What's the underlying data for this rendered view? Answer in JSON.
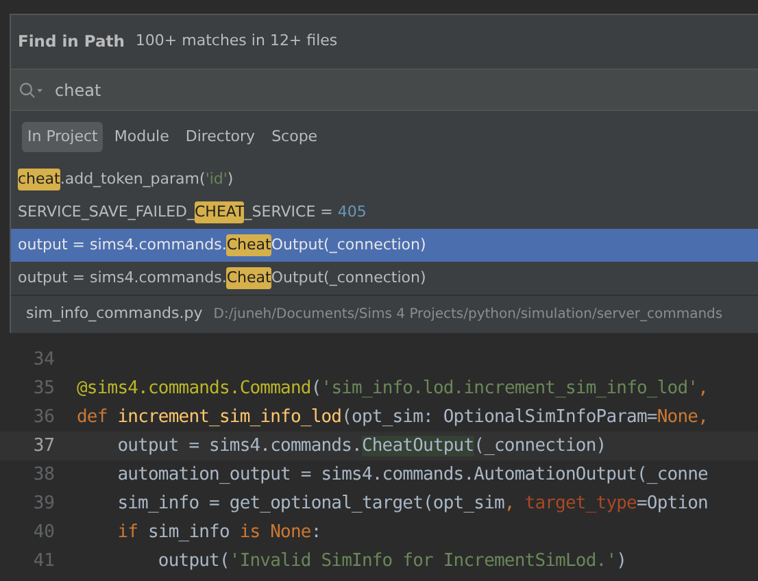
{
  "dialog": {
    "title": "Find in Path",
    "summary": "100+ matches in 12+ files",
    "search": {
      "value": "cheat"
    },
    "scopes": [
      {
        "label": "In Project",
        "selected": true
      },
      {
        "label": "Module",
        "selected": false
      },
      {
        "label": "Directory",
        "selected": false
      },
      {
        "label": "Scope",
        "selected": false
      }
    ],
    "results": [
      {
        "selected": false,
        "segments": [
          {
            "text": "cheat",
            "kind": "match"
          },
          {
            "text": ".add_token_param(",
            "kind": "plain"
          },
          {
            "text": "'id'",
            "kind": "string"
          },
          {
            "text": ")",
            "kind": "plain"
          }
        ]
      },
      {
        "selected": false,
        "segments": [
          {
            "text": "SERVICE_SAVE_FAILED_",
            "kind": "plain"
          },
          {
            "text": "CHEAT",
            "kind": "match"
          },
          {
            "text": "_SERVICE = ",
            "kind": "plain"
          },
          {
            "text": "405",
            "kind": "number"
          }
        ]
      },
      {
        "selected": true,
        "segments": [
          {
            "text": "output = sims4.commands.",
            "kind": "plain"
          },
          {
            "text": "Cheat",
            "kind": "match"
          },
          {
            "text": "Output(_connection)",
            "kind": "plain"
          }
        ]
      },
      {
        "selected": false,
        "segments": [
          {
            "text": "output = sims4.commands.",
            "kind": "plain"
          },
          {
            "text": "Cheat",
            "kind": "match"
          },
          {
            "text": "Output(_connection)",
            "kind": "plain"
          }
        ]
      }
    ],
    "preview": {
      "file": "sim_info_commands.py",
      "path": "D:/juneh/Documents/Sims 4 Projects/python/simulation/server_commands"
    }
  },
  "editor": {
    "lines": [
      {
        "number": "34",
        "current": false
      },
      {
        "number": "35",
        "current": false,
        "segments": [
          {
            "text": "@sims4.commands.Command",
            "kind": "decorator"
          },
          {
            "text": "(",
            "kind": "plain"
          },
          {
            "text": "'sim_info.lod.increment_sim_info_lod'",
            "kind": "string"
          },
          {
            "text": ",",
            "kind": "punct"
          }
        ]
      },
      {
        "number": "36",
        "current": false,
        "segments": [
          {
            "text": "def ",
            "kind": "keyword"
          },
          {
            "text": "increment_sim_info_lod",
            "kind": "function"
          },
          {
            "text": "(opt_sim: OptionalSimInfoParam=",
            "kind": "plain"
          },
          {
            "text": "None",
            "kind": "keyword"
          },
          {
            "text": ",",
            "kind": "punct"
          }
        ]
      },
      {
        "number": "37",
        "current": true,
        "segments": [
          {
            "text": "    output = sims4.commands.",
            "kind": "plain"
          },
          {
            "text": "CheatOutput",
            "kind": "match"
          },
          {
            "text": "(_connection)",
            "kind": "plain"
          }
        ]
      },
      {
        "number": "38",
        "current": false,
        "segments": [
          {
            "text": "    automation_output = sims4.commands.AutomationOutput(_conne",
            "kind": "plain"
          }
        ]
      },
      {
        "number": "39",
        "current": false,
        "segments": [
          {
            "text": "    sim_info = get_optional_target(opt_sim",
            "kind": "plain"
          },
          {
            "text": ", ",
            "kind": "punct"
          },
          {
            "text": "target_type",
            "kind": "param"
          },
          {
            "text": "=Option",
            "kind": "plain"
          }
        ]
      },
      {
        "number": "40",
        "current": false,
        "segments": [
          {
            "text": "    if",
            "kind": "keyword"
          },
          {
            "text": " sim_info ",
            "kind": "plain"
          },
          {
            "text": "is ",
            "kind": "keyword"
          },
          {
            "text": "None",
            "kind": "keyword"
          },
          {
            "text": ":",
            "kind": "plain"
          }
        ]
      },
      {
        "number": "41",
        "current": false,
        "segments": [
          {
            "text": "        output(",
            "kind": "plain"
          },
          {
            "text": "'Invalid SimInfo for IncrementSimLod.'",
            "kind": "string"
          },
          {
            "text": ")",
            "kind": "plain"
          }
        ]
      }
    ]
  }
}
